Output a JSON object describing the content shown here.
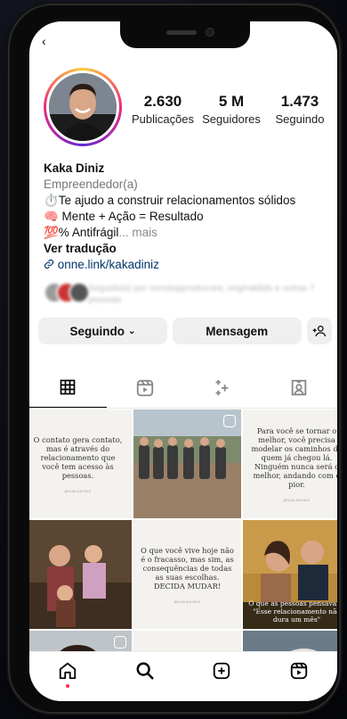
{
  "profile": {
    "name": "Kaka Diniz",
    "category": "Empreendedor(a)",
    "bio_line1": "⏱️Te ajudo a construir relacionamentos sólidos",
    "bio_line2": "🧠 Mente + Ação = Resultado",
    "bio_line3": "💯% Antifrágil",
    "more": "... mais",
    "translate": "Ver tradução",
    "link": "onne.link/kakadiniz"
  },
  "stats": {
    "posts_value": "2.630",
    "posts_label": "Publicações",
    "followers_value": "5 M",
    "followers_label": "Seguidores",
    "following_value": "1.473",
    "following_label": "Seguindo"
  },
  "followed_by": "Seguido(a) por nonstopproducoes, originaldids e outras 7 pessoas",
  "buttons": {
    "following": "Seguindo",
    "message": "Mensagem"
  },
  "posts": {
    "p1": "O contato gera contato, mas é através do relacionamento que você tem acesso às pessoas.",
    "p1_sig": "@KAKADINIZ",
    "p3": "Para você se tornar o melhor, você precisa modelar os caminhos de quem já chegou lá. Ninguém nunca será o melhor, andando com o pior.",
    "p3_sig": "@KAKADINIZ",
    "p5": "O que você vive hoje não é o fracasso, mas sim, as consequências de todas as suas escolhas. DECIDA MUDAR!",
    "p5_sig": "@KAKADINIZ",
    "p6": "O que as pessoas pensavam: \"Esse relacionamento não dura um mês\""
  },
  "colors": {
    "accent_link": "#00376b",
    "notification_dot": "#ff3040"
  }
}
